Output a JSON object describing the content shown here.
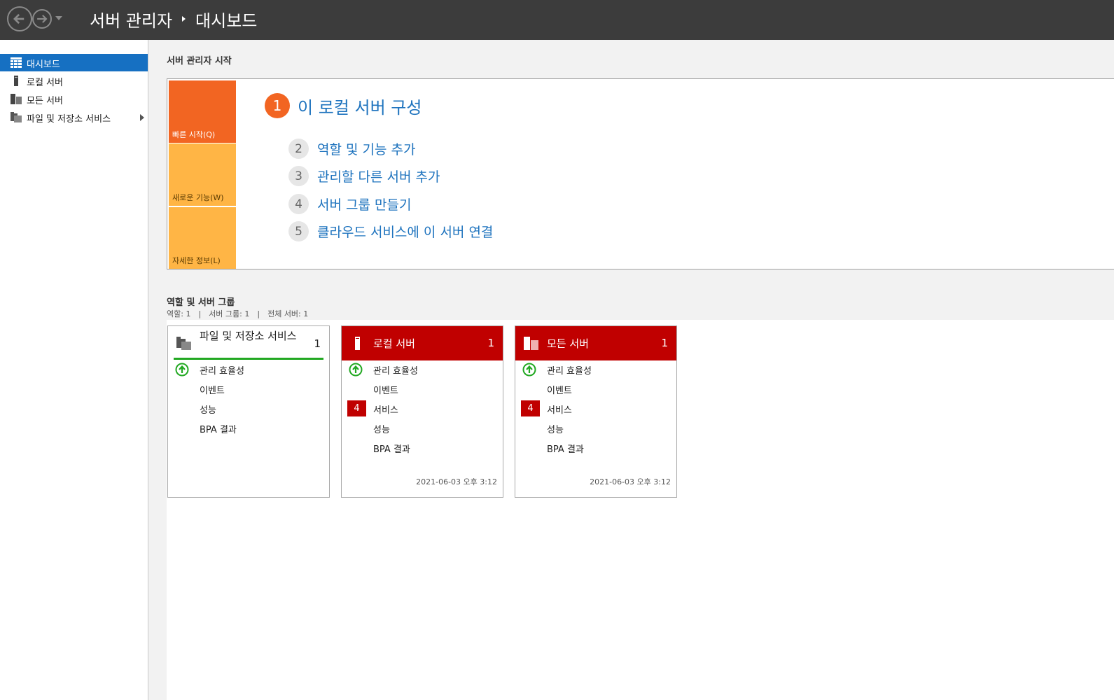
{
  "titlebar": {
    "breadcrumb_root": "서버 관리자",
    "breadcrumb_current": "대시보드"
  },
  "sidebar": {
    "items": [
      {
        "label": "대시보드",
        "icon": "dashboard-icon",
        "active": true
      },
      {
        "label": "로컬 서버",
        "icon": "local-server-icon"
      },
      {
        "label": "모든 서버",
        "icon": "all-servers-icon"
      },
      {
        "label": "파일 및 저장소 서비스",
        "icon": "file-storage-icon",
        "expandable": true
      }
    ]
  },
  "quickstart": {
    "heading": "서버 관리자 시작",
    "tiles": [
      "빠른 시작(Q)",
      "새로운 기능(W)",
      "자세한 정보(L)"
    ],
    "steps": [
      {
        "num": "1",
        "label": "이 로컬 서버 구성"
      },
      {
        "num": "2",
        "label": "역할 및 기능 추가"
      },
      {
        "num": "3",
        "label": "관리할 다른 서버 추가"
      },
      {
        "num": "4",
        "label": "서버 그룹 만들기"
      },
      {
        "num": "5",
        "label": "클라우드 서비스에 이 서버 연결"
      }
    ]
  },
  "roles": {
    "heading": "역할 및 서버 그룹",
    "summary": {
      "roles": "역할: 1",
      "groups": "서버 그룹: 1",
      "total": "전체 서버: 1",
      "separator": "|"
    },
    "cards": [
      {
        "title": "파일 및 저장소 서비스",
        "count": "1",
        "rows": [
          "관리 효율성",
          "이벤트",
          "성능",
          "BPA 결과"
        ],
        "timestamp": ""
      },
      {
        "title": "로컬 서버",
        "count": "1",
        "rows": [
          "관리 효율성",
          "이벤트",
          "서비스",
          "성능",
          "BPA 결과"
        ],
        "services_alert": "4",
        "timestamp": "2021-06-03 오후 3:12"
      },
      {
        "title": "모든 서버",
        "count": "1",
        "rows": [
          "관리 효율성",
          "이벤트",
          "서비스",
          "성능",
          "BPA 결과"
        ],
        "services_alert": "4",
        "timestamp": "2021-06-03 오후 3:12"
      }
    ]
  },
  "colors": {
    "titlebar": "#3c3c3c",
    "active_nav": "#1670c2",
    "quickstart_orange": "#f26522",
    "tile_yellow": "#ffb545",
    "link_blue": "#1e73be",
    "alert_red": "#c00000",
    "ok_green": "#22a822"
  }
}
